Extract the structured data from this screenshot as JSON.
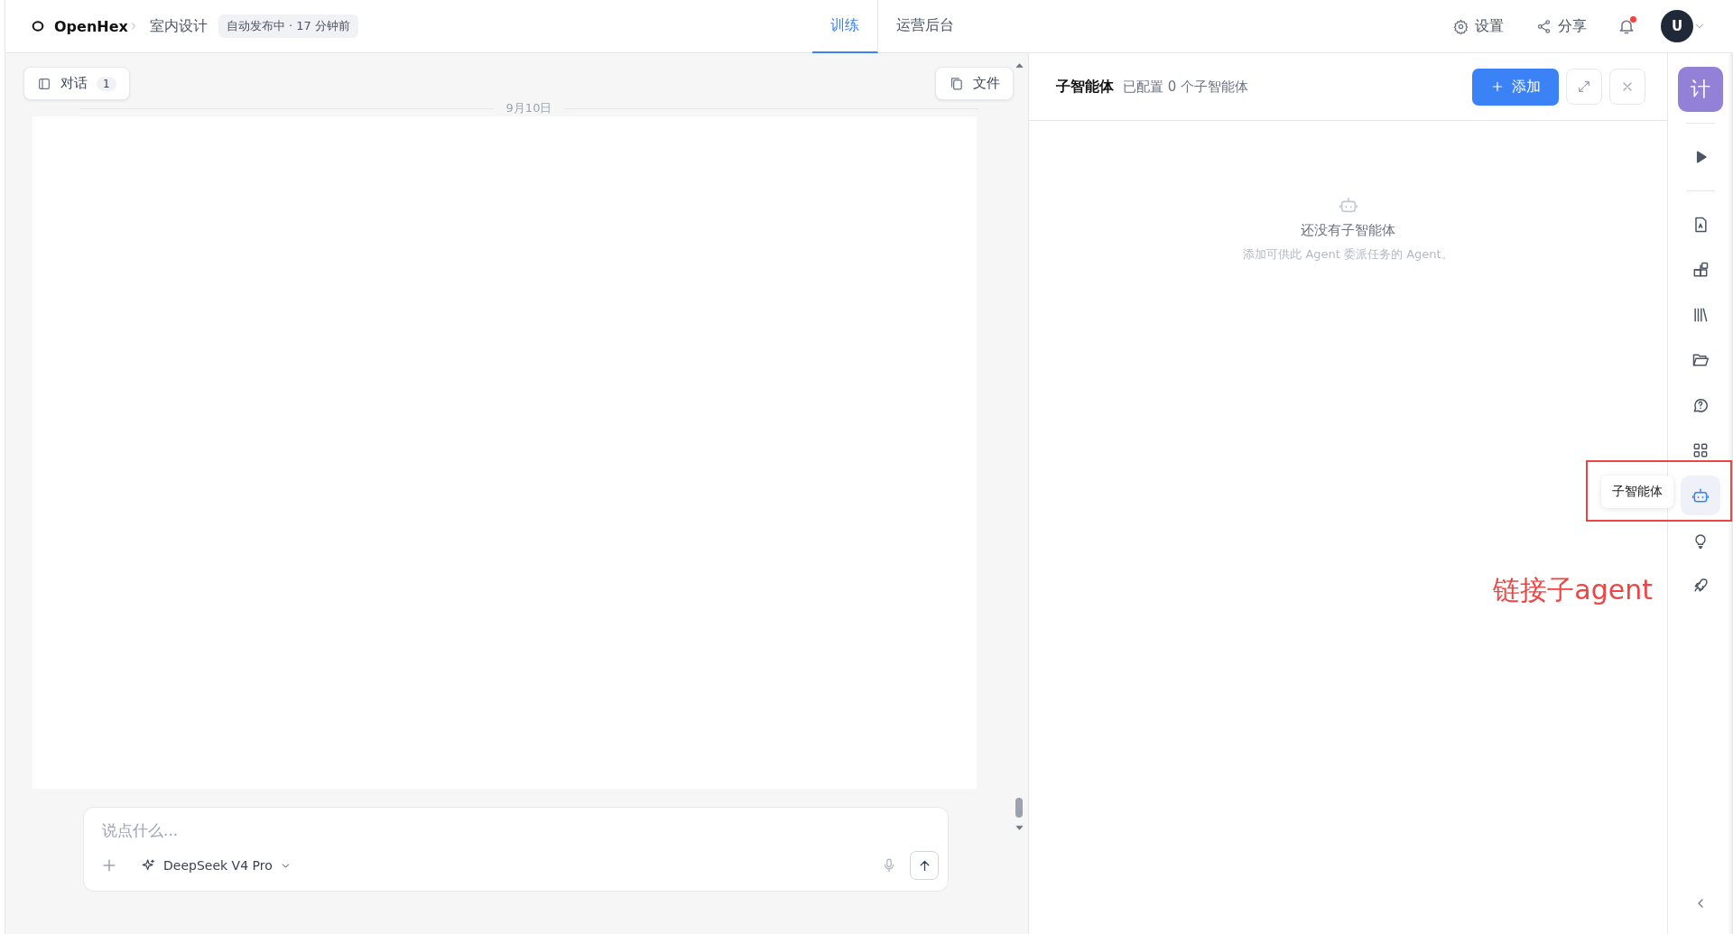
{
  "header": {
    "brand": "OpenHex",
    "breadcrumb": "室内设计",
    "status_badge": "自动发布中 · 17 分钟前",
    "tabs": [
      {
        "label": "训练",
        "selected": true
      },
      {
        "label": "运营后台",
        "selected": false
      }
    ],
    "actions": [
      {
        "kind": "settings",
        "label": "设置"
      },
      {
        "kind": "share",
        "label": "分享"
      }
    ],
    "notification_unread": true,
    "avatar": "U"
  },
  "chat": {
    "conversations_button": {
      "label": "对话",
      "count": "1"
    },
    "files_button": "文件",
    "date_divider": "9月10日",
    "composer": {
      "placeholder": "说点什么...",
      "model": "DeepSeek V4 Pro"
    }
  },
  "panel": {
    "title": "子智能体",
    "subtitle": "已配置 0 个子智能体",
    "add_button": "添加",
    "empty_title": "还没有子智能体",
    "empty_hint": "添加可供此 Agent 委派任务的 Agent。"
  },
  "rail": {
    "avatar": "计",
    "items": [
      {
        "kind": "play",
        "selected": false
      },
      {
        "kind": "doc",
        "selected": false
      },
      {
        "kind": "widgets",
        "selected": false
      },
      {
        "kind": "library",
        "selected": false
      },
      {
        "kind": "folder",
        "selected": false
      },
      {
        "kind": "help",
        "selected": false
      },
      {
        "kind": "grid",
        "selected": false
      },
      {
        "kind": "robot",
        "selected": true,
        "tooltip": "子智能体"
      },
      {
        "kind": "bulb",
        "selected": false
      },
      {
        "kind": "rocket",
        "selected": false
      }
    ]
  },
  "annotation": {
    "text": "链接子agent"
  }
}
